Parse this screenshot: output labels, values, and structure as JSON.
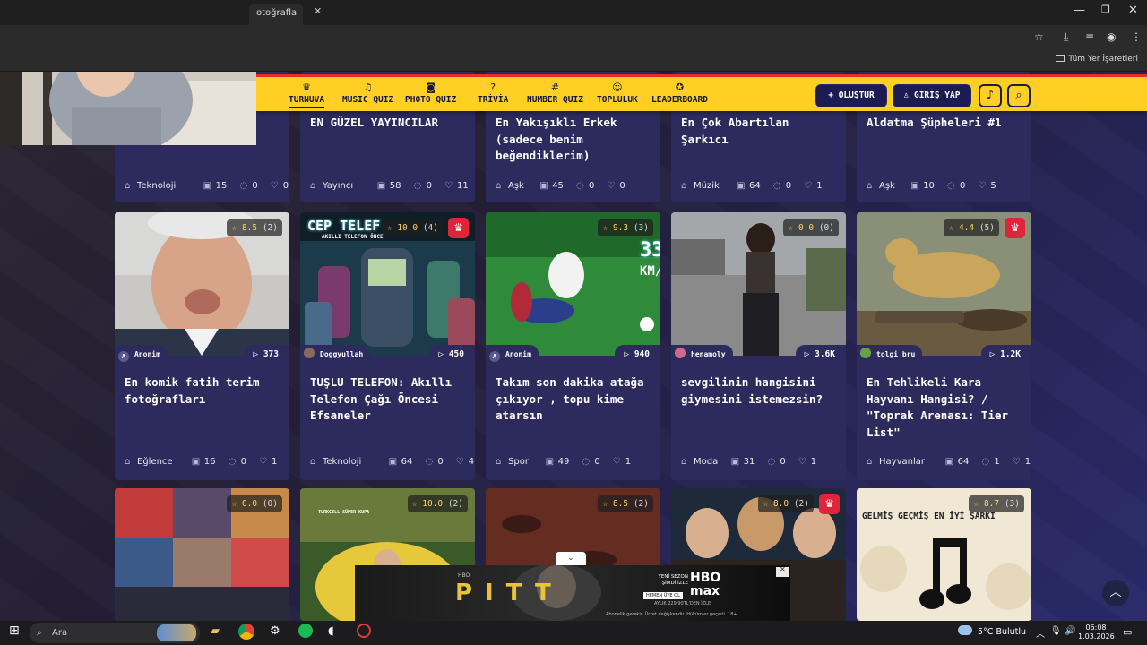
{
  "browser": {
    "tab_title": "otoğrafla",
    "bookmarks_all": "Tüm Yer İşaretleri"
  },
  "nav": [
    {
      "label": "TURNUVA",
      "icon": "trophy-icon"
    },
    {
      "label": "MUSIC QUIZ",
      "icon": "music-icon"
    },
    {
      "label": "PHOTO QUIZ",
      "icon": "camera-icon"
    },
    {
      "label": "TRİVİA",
      "icon": "question-icon"
    },
    {
      "label": "NUMBER QUIZ",
      "icon": "hash-icon"
    },
    {
      "label": "TOPLULUK",
      "icon": "users-icon"
    },
    {
      "label": "LEADERBOARD",
      "icon": "medal-icon"
    }
  ],
  "header": {
    "create_label": "+ OLUŞTUR",
    "login_label": "GİRİŞ YAP"
  },
  "row1": [
    {
      "title": "",
      "category": "Teknoloji",
      "questions": "15",
      "comments": "0",
      "likes": "0"
    },
    {
      "title": "EN GÜZEL YAYINCILAR",
      "category": "Yayıncı",
      "questions": "58",
      "comments": "0",
      "likes": "11"
    },
    {
      "title": "En Yakışıklı Erkek (sadece benim beğendiklerim)",
      "category": "Aşk",
      "questions": "45",
      "comments": "0",
      "likes": "0"
    },
    {
      "title": "En Çok Abartılan Şarkıcı",
      "category": "Müzik",
      "questions": "64",
      "comments": "0",
      "likes": "1"
    },
    {
      "title": "Aldatma Şüpheleri #1",
      "category": "Aşk",
      "questions": "10",
      "comments": "0",
      "likes": "5"
    }
  ],
  "row2": [
    {
      "rating": "8.5",
      "rating_count": "(2)",
      "crown": false,
      "author": "Anonim",
      "avatar": "A",
      "plays": "373",
      "title": "En komik fatih terim fotoğrafları",
      "category": "Eğlence",
      "questions": "16",
      "comments": "0",
      "likes": "1"
    },
    {
      "rating": "10.0",
      "rating_count": "(4)",
      "crown": true,
      "author": "Doggyullah",
      "avatar": "",
      "plays": "450",
      "title": "TUŞLU TELEFON: Akıllı Telefon Çağı Öncesi Efsaneler",
      "category": "Teknoloji",
      "questions": "64",
      "comments": "0",
      "likes": "4",
      "img_text": "CEP TELEF",
      "img_sub": "AKILLI TELEFON ÖNCE"
    },
    {
      "rating": "9.3",
      "rating_count": "(3)",
      "crown": false,
      "author": "Anonim",
      "avatar": "A",
      "plays": "940",
      "title": "Takım son dakika atağa çıkıyor , topu kime atarsın",
      "category": "Spor",
      "questions": "49",
      "comments": "0",
      "likes": "1",
      "img_text": "33",
      "img_sub": "KM/"
    },
    {
      "rating": "0.0",
      "rating_count": "(0)",
      "crown": false,
      "author": "henamoly",
      "avatar": "",
      "plays": "3.6K",
      "title": "sevgilinin hangisini giymesini istemezsin?",
      "category": "Moda",
      "questions": "31",
      "comments": "0",
      "likes": "1"
    },
    {
      "rating": "4.4",
      "rating_count": "(5)",
      "crown": true,
      "author": "tolgi bru",
      "avatar": "",
      "plays": "1.2K",
      "title": "En Tehlikeli Kara Hayvanı Hangisi? / \"Toprak Arenası: Tier List\"",
      "category": "Hayvanlar",
      "questions": "64",
      "comments": "1",
      "likes": "1"
    }
  ],
  "row3": [
    {
      "rating": "0.0",
      "rating_count": "(0)",
      "crown": false
    },
    {
      "rating": "10.0",
      "rating_count": "(2)",
      "crown": false,
      "img_text": "TURKCELL SÜPER KUPA"
    },
    {
      "rating": "8.5",
      "rating_count": "(2)",
      "crown": false
    },
    {
      "rating": "8.0",
      "rating_count": "(2)",
      "crown": true
    },
    {
      "rating": "8.7",
      "rating_count": "(3)",
      "crown": false,
      "img_text": "GELMİŞ GEÇMİŞ EN İYİ ŞARKI"
    }
  ],
  "ad": {
    "left_tag": "HBO",
    "title": "PITT",
    "new_season": "YENİ SEZON",
    "watch_now": "ŞİMDİ İZLE",
    "brand": "HBO max",
    "cta": "HEMEN ÜYE OL",
    "price": "AYLIK 229,90TL'DEN İZLE",
    "disclaimer": "Abonelik gerekir. Ücret değişkendir. Hükümler geçerli. 18+"
  },
  "taskbar": {
    "search_placeholder": "Ara",
    "weather": "5°C  Bulutlu",
    "time": "06:08",
    "date": "1.03.2026"
  }
}
